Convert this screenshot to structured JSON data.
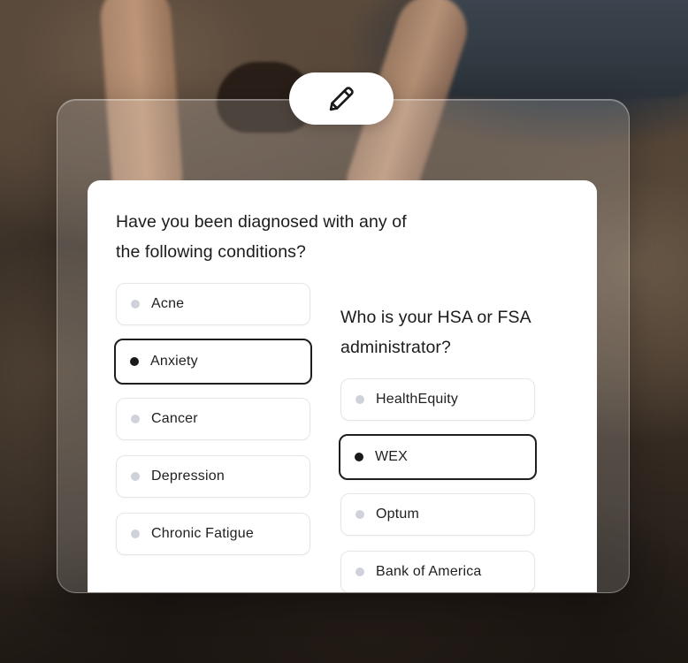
{
  "conditions_question": {
    "line1": "Have you been diagnosed with any of",
    "line2": "the following conditions?",
    "options": [
      {
        "label": "Acne",
        "selected": false
      },
      {
        "label": "Anxiety",
        "selected": true
      },
      {
        "label": "Cancer",
        "selected": false
      },
      {
        "label": "Depression",
        "selected": false
      },
      {
        "label": "Chronic Fatigue",
        "selected": false
      }
    ]
  },
  "administrator_question": {
    "line1": "Who is your HSA or FSA",
    "line2": "administrator?",
    "options": [
      {
        "label": "HealthEquity",
        "selected": false
      },
      {
        "label": "WEX",
        "selected": true
      },
      {
        "label": "Optum",
        "selected": false
      },
      {
        "label": "Bank of America",
        "selected": false
      }
    ]
  },
  "edit_button": {
    "icon": "pencil-icon"
  },
  "colors": {
    "selected_border": "#1f1f1f",
    "unselected_border": "#e6e6e6",
    "selected_dot": "#1a1a1a",
    "unselected_dot": "#cfd2db",
    "card_background": "#ffffff"
  }
}
